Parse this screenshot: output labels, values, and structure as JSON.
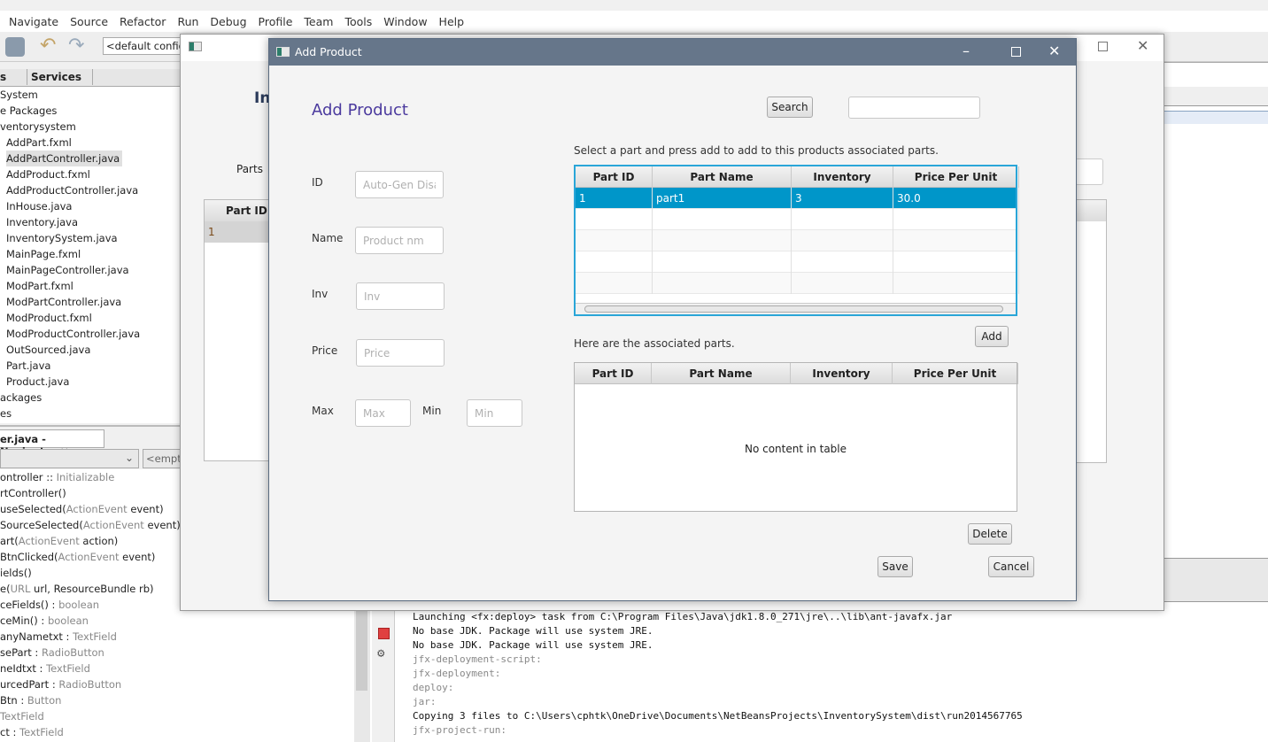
{
  "ide": {
    "menu": [
      "Navigate",
      "Source",
      "Refactor",
      "Run",
      "Debug",
      "Profile",
      "Team",
      "Tools",
      "Window",
      "Help"
    ],
    "config": "<default config>",
    "project_tabs": [
      "s",
      "Services"
    ],
    "tree": [
      "System",
      "e Packages",
      "ventorysystem",
      "AddPart.fxml",
      "AddPartController.java",
      "AddProduct.fxml",
      "AddProductController.java",
      "InHouse.java",
      "Inventory.java",
      "InventorySystem.java",
      "MainPage.fxml",
      "MainPageController.java",
      "ModPart.fxml",
      "ModPartController.java",
      "ModProduct.fxml",
      "ModProductController.java",
      "OutSourced.java",
      "Part.java",
      "Product.java",
      "ackages",
      "es"
    ],
    "navigator_tab": "er.java - Navigator",
    "navigator_combo2": "<empty",
    "navigator": [
      {
        "a": "ontroller :: ",
        "t": "Initializable",
        "b": ""
      },
      {
        "a": "rtController()",
        "t": "",
        "b": ""
      },
      {
        "a": "useSelected(",
        "t": "ActionEvent",
        "b": " event)"
      },
      {
        "a": "SourceSelected(",
        "t": "ActionEvent",
        "b": " event)"
      },
      {
        "a": "art(",
        "t": "ActionEvent",
        "b": " action)"
      },
      {
        "a": "BtnClicked(",
        "t": "ActionEvent",
        "b": " event)"
      },
      {
        "a": "ields()",
        "t": "",
        "b": ""
      },
      {
        "a": "e(",
        "t": "URL",
        "b": " url, ResourceBundle rb)"
      },
      {
        "a": "ceFields() : ",
        "t": "boolean",
        "b": ""
      },
      {
        "a": "ceMin() : ",
        "t": "boolean",
        "b": ""
      },
      {
        "a": "anyNametxt : ",
        "t": "TextField",
        "b": ""
      },
      {
        "a": "sePart : ",
        "t": "RadioButton",
        "b": ""
      },
      {
        "a": "neIdtxt : ",
        "t": "TextField",
        "b": ""
      },
      {
        "a": "urcedPart : ",
        "t": "RadioButton",
        "b": ""
      },
      {
        "a": "Btn : ",
        "t": "Button",
        "b": ""
      },
      {
        "a": " ",
        "t": "TextField",
        "b": ""
      },
      {
        "a": "ct : ",
        "t": "TextField",
        "b": ""
      }
    ],
    "output": [
      {
        "text": "Launching <fx:deploy> task from C:\\Program Files\\Java\\jdk1.8.0_271\\jre\\..\\lib\\ant-javafx.jar",
        "dim": false
      },
      {
        "text": "No base JDK. Package will use system JRE.",
        "dim": false
      },
      {
        "text": "No base JDK. Package will use system JRE.",
        "dim": false
      },
      {
        "text": "jfx-deployment-script:",
        "dim": true
      },
      {
        "text": "jfx-deployment:",
        "dim": true
      },
      {
        "text": "deploy:",
        "dim": true
      },
      {
        "text": "jar:",
        "dim": true
      },
      {
        "text": "Copying 3 files to C:\\Users\\cphtk\\OneDrive\\Documents\\NetBeansProjects\\InventorySystem\\dist\\run2014567765",
        "dim": false
      },
      {
        "text": "jfx-project-run:",
        "dim": true
      }
    ]
  },
  "main_window": {
    "heading": "In",
    "parts_label": "Parts",
    "col": "Part ID",
    "row1": "1"
  },
  "dialog": {
    "title": "Add Product",
    "heading": "Add Product",
    "search_button": "Search",
    "search_value": "",
    "labels": {
      "id": "ID",
      "name": "Name",
      "inv": "Inv",
      "price": "Price",
      "max": "Max",
      "min": "Min"
    },
    "placeholders": {
      "id": "Auto-Gen Disab",
      "name": "Product nm",
      "inv": "Inv",
      "price": "Price",
      "max": "Max",
      "min": "Min"
    },
    "instruction": "Select a part and press add to add to this products associated parts.",
    "columns": [
      "Part ID",
      "Part Name",
      "Inventory",
      "Price Per Unit"
    ],
    "parts": [
      {
        "id": "1",
        "name": "part1",
        "inventory": "3",
        "price": "30.0"
      }
    ],
    "associated_label": "Here are the associated parts.",
    "add_button": "Add",
    "empty_text": "No content in table",
    "delete_button": "Delete",
    "save_button": "Save",
    "cancel_button": "Cancel",
    "accent": "#0096c9",
    "heading_color": "#4b3a9e"
  }
}
